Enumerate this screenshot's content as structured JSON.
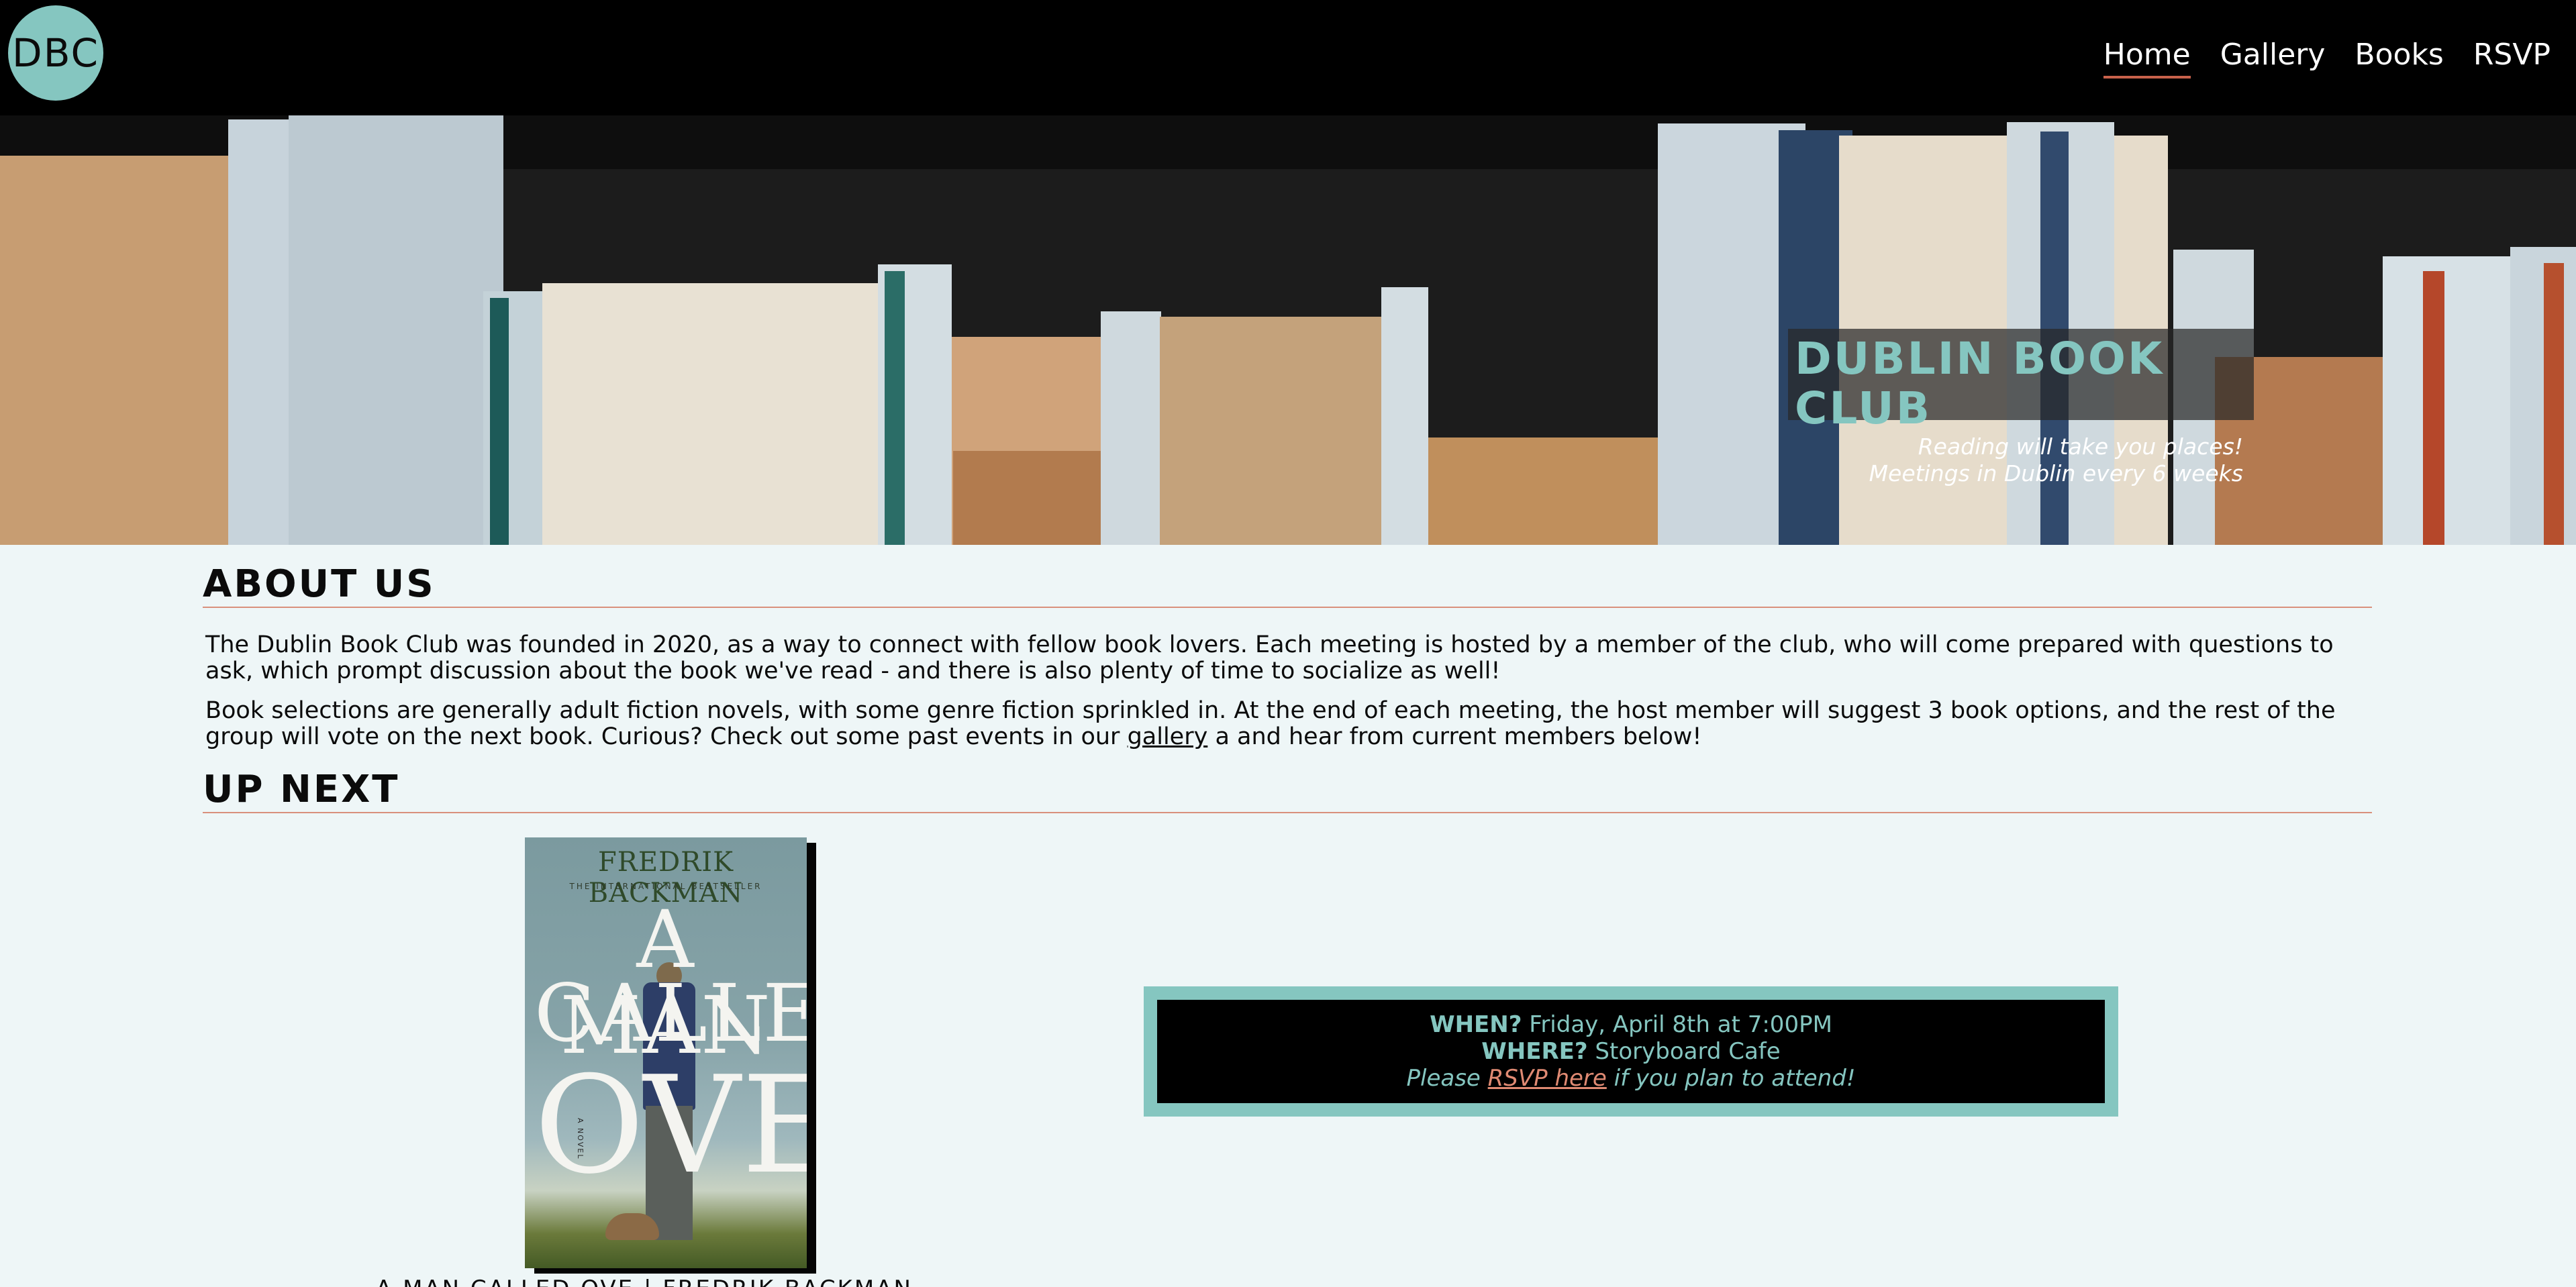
{
  "nav": {
    "logo_text": "DBC",
    "links": [
      {
        "label": "Home",
        "active": true
      },
      {
        "label": "Gallery",
        "active": false
      },
      {
        "label": "Books",
        "active": false
      },
      {
        "label": "RSVP",
        "active": false
      }
    ]
  },
  "hero": {
    "title": "DUBLIN BOOK CLUB",
    "tagline": "Reading will take you places!",
    "schedule": "Meetings in Dublin every 6 weeks"
  },
  "about": {
    "heading": "ABOUT US",
    "p1": "The Dublin Book Club was founded in 2020, as a way to connect with fellow book lovers. Each meeting is hosted by a member of the club, who will come prepared with questions to ask, which prompt discussion about the book we've read - and there is also plenty of time to socialize as well!",
    "p2_before": "Book selections are generally adult fiction novels, with some genre fiction sprinkled in. At the end of each meeting, the host member will suggest 3 book options, and the rest of the group will vote on the next book. Curious? Check out some past events in our ",
    "p2_link": "gallery",
    "p2_after": " a and hear from current members below!"
  },
  "upnext": {
    "heading": "UP NEXT",
    "cover": {
      "author": "FREDRIK BACKMAN",
      "tagline": "THE INTERNATIONAL BESTSELLER",
      "title_1": "A MAN",
      "title_2": "CALLED",
      "title_3": "OVE",
      "novel": "A NOVEL"
    },
    "caption": "A MAN CALLED OVE | FREDRIK BACKMAN",
    "event": {
      "when_label": "WHEN?",
      "when_value": " Friday, April 8th at 7:00PM",
      "where_label": "WHERE?",
      "where_value": " Storyboard Cafe",
      "rsvp_prefix": "Please ",
      "rsvp_link": "RSVP here",
      "rsvp_suffix": " if you plan to attend!"
    }
  },
  "colors": {
    "accent_teal": "#85c6c0",
    "accent_salmon": "#d9907c",
    "nav_bg": "#000000",
    "page_bg": "#eef6f7"
  }
}
